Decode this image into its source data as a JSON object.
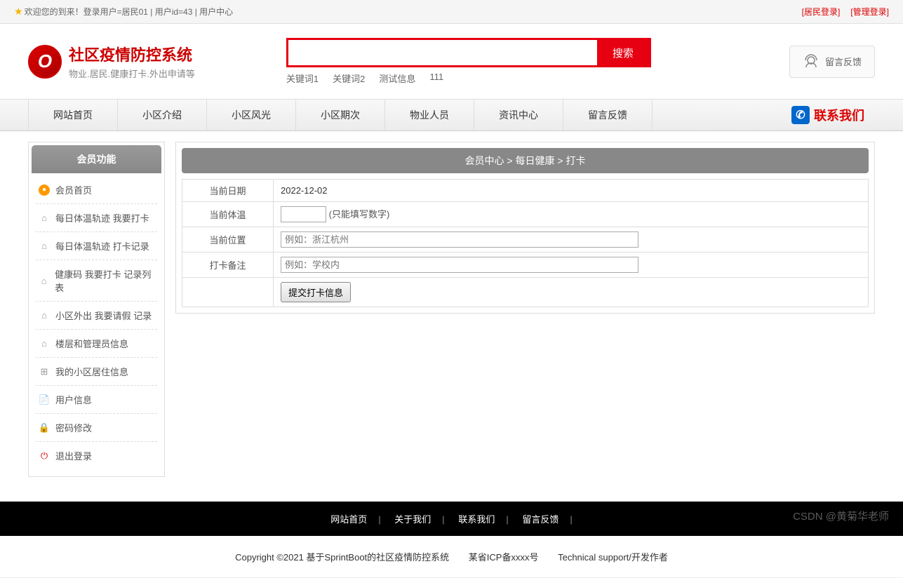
{
  "topbar": {
    "welcome": "欢迎您的到来！登录用户=居民01 | 用户id=43 | 用户中心",
    "login_resident": "[居民登录]",
    "login_admin": "[管理登录]"
  },
  "logo": {
    "title": "社区疫情防控系统",
    "subtitle": "物业.居民.健康打卡.外出申请等"
  },
  "search": {
    "button": "搜索",
    "keywords": [
      "关键词1",
      "关键词2",
      "测试信息",
      "111"
    ]
  },
  "feedback_btn": "留言反馈",
  "nav": {
    "items": [
      "网站首页",
      "小区介绍",
      "小区风光",
      "小区期次",
      "物业人员",
      "资讯中心",
      "留言反馈"
    ],
    "contact": "联系我们"
  },
  "sidebar": {
    "header": "会员功能",
    "items": [
      "会员首页",
      "每日体温轨迹 我要打卡",
      "每日体温轨迹 打卡记录",
      "健康码 我要打卡 记录列表",
      "小区外出 我要请假 记录",
      "楼层和管理员信息",
      "我的小区居住信息",
      "用户信息",
      "密码修改",
      "退出登录"
    ]
  },
  "breadcrumb": "会员中心 > 每日健康 > 打卡",
  "form": {
    "date_label": "当前日期",
    "date_value": "2022-12-02",
    "temp_label": "当前体温",
    "temp_hint": "(只能填写数字)",
    "loc_label": "当前位置",
    "loc_placeholder": "例如：浙江杭州",
    "note_label": "打卡备注",
    "note_placeholder": "例如：学校内",
    "submit": "提交打卡信息"
  },
  "footer": {
    "nav": [
      "网站首页",
      "关于我们",
      "联系我们",
      "留言反馈"
    ],
    "copyright": "Copyright ©2021 基于SprintBoot的社区疫情防控系统",
    "icp": "某省ICP备xxxx号",
    "tech": "Technical support/开发作者"
  },
  "watermark": "CSDN @黄菊华老师"
}
